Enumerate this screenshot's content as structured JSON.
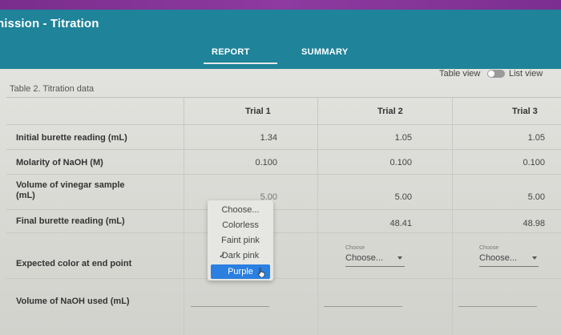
{
  "header": {
    "title": "nission - Titration",
    "tabs": [
      {
        "label": "REPORT",
        "active": true
      },
      {
        "label": "SUMMARY",
        "active": false
      }
    ],
    "colors": {
      "banner": "#1f8399",
      "topbar": "#8e3aa0",
      "selected": "#2a7fe0"
    }
  },
  "view_toggle": {
    "table_view": "Table view",
    "list_view": "List view"
  },
  "table": {
    "caption": "Table 2. Titration data",
    "columns": [
      "Trial 1",
      "Trial 2",
      "Trial 3"
    ],
    "rows": [
      {
        "label": "Initial burette reading (mL)",
        "values": [
          "1.34",
          "1.05",
          "1.05"
        ]
      },
      {
        "label": "Molarity of NaOH (M)",
        "values": [
          "0.100",
          "0.100",
          "0.100"
        ]
      },
      {
        "label": "Volume of vinegar sample (mL)",
        "values": [
          "5.00",
          "5.00",
          "5.00"
        ]
      },
      {
        "label": "Final burette reading (mL)",
        "values": [
          "",
          "48.41",
          "48.98"
        ]
      },
      {
        "label": "Expected color at end point",
        "values": [
          "",
          "Choose...",
          "Choose..."
        ]
      },
      {
        "label": "Volume of NaOH used (mL)",
        "values": [
          "",
          "",
          ""
        ]
      }
    ],
    "select_mini_label": "Choose"
  },
  "dropdown": {
    "options": [
      "Choose...",
      "Colorless",
      "Faint pink",
      "Dark pink",
      "Purple"
    ],
    "checked": "Dark pink",
    "highlighted": "Purple"
  }
}
